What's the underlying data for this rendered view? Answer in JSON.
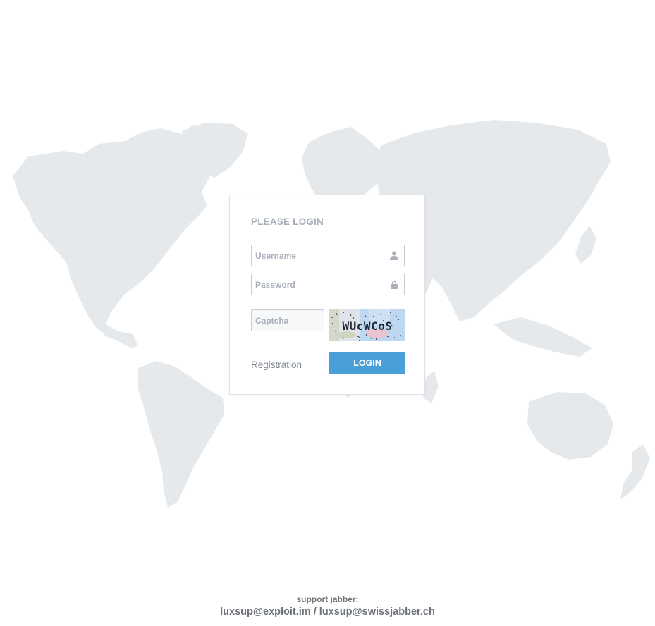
{
  "login": {
    "title": "PLEASE LOGIN",
    "username_placeholder": "Username",
    "password_placeholder": "Password",
    "captcha_placeholder": "Captcha",
    "captcha_text": "WUcWCoS",
    "registration_label": "Registration",
    "login_label": "LOGIN"
  },
  "footer": {
    "label": "support jabber:",
    "contact_1": "luxsup@exploit.im",
    "separator": " / ",
    "contact_2": "luxsup@swissjabber.ch"
  },
  "icons": {
    "username": "user-icon",
    "password": "lock-icon"
  },
  "colors": {
    "accent": "#4a9fd8",
    "map": "#e6e9ec",
    "title": "#a6aeb9",
    "footer_text": "#6f747b"
  }
}
